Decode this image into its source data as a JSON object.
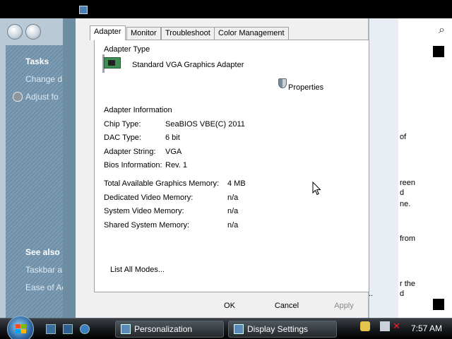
{
  "background_left": {
    "tasks_title": "Tasks",
    "link_1": "Change d",
    "link_2": "Adjust fo",
    "see_also_title": "See also",
    "see_link_1": "Taskbar a",
    "see_link_2": "Ease of Ac"
  },
  "background_right": {
    "frag_1": "of",
    "frag_2": "reen",
    "frag_3": "d",
    "frag_4": "ne.",
    "frag_5": "from",
    "frag_6": "r the",
    "frag_7": "d",
    "dots": ".."
  },
  "tabs": [
    "Adapter",
    "Monitor",
    "Troubleshoot",
    "Color Management"
  ],
  "adapter": {
    "type_heading": "Adapter Type",
    "adapter_name": "Standard VGA Graphics Adapter",
    "properties_label": "Properties",
    "info_heading": "Adapter Information",
    "chip_type_label": "Chip Type:",
    "chip_type_value": "SeaBIOS VBE(C) 2011",
    "dac_type_label": "DAC Type:",
    "dac_type_value": "6 bit",
    "adapter_string_label": "Adapter String:",
    "adapter_string_value": "VGA",
    "bios_info_label": "Bios Information:",
    "bios_info_value": "Rev. 1",
    "total_mem_label": "Total Available Graphics Memory:",
    "total_mem_value": "4 MB",
    "dedicated_mem_label": "Dedicated Video Memory:",
    "dedicated_mem_value": "n/a",
    "system_mem_label": "System Video Memory:",
    "system_mem_value": "n/a",
    "shared_mem_label": "Shared System Memory:",
    "shared_mem_value": "n/a",
    "list_modes_label": "List All Modes..."
  },
  "buttons": {
    "ok": "OK",
    "cancel": "Cancel",
    "apply": "Apply"
  },
  "taskbar": {
    "task_1": "Personalization",
    "task_2": "Display Settings",
    "clock": "7:57 AM"
  }
}
